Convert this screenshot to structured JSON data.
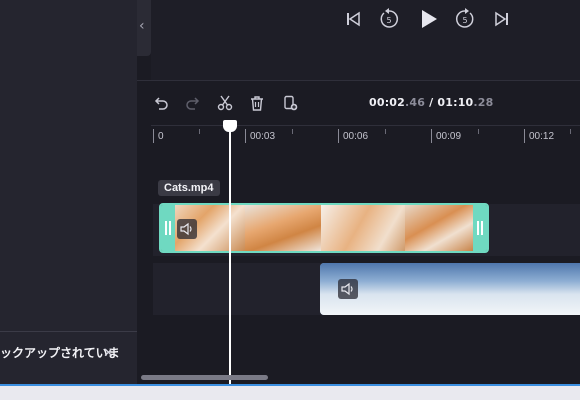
{
  "sidebar": {
    "collapse_icon": "chevron-left-icon",
    "backup_message": "ックアップされていま",
    "close_icon": "close-icon"
  },
  "playback": {
    "buttons": [
      "skip-back-icon",
      "rewind-5-icon",
      "play-icon",
      "forward-5-icon",
      "skip-forward-icon"
    ],
    "skip_seconds": "5"
  },
  "toolbar": {
    "tools": [
      "undo-icon",
      "redo-icon",
      "cut-icon",
      "delete-icon",
      "duplicate-icon"
    ]
  },
  "timecode": {
    "current_main": "00:02",
    "current_frac": ".46",
    "separator": " / ",
    "total_main": "01:10",
    "total_frac": ".28"
  },
  "ruler": {
    "labels": [
      "0",
      "00:03",
      "00:06",
      "00:09",
      "00:12"
    ]
  },
  "clips": {
    "video1": {
      "name": "Cats.mp4"
    },
    "video2": {
      "name": ""
    }
  },
  "colors": {
    "accent": "#6fd9c1",
    "background": "#1b1b23",
    "panel": "#25252f",
    "selection_border": "#3b8fe0"
  }
}
